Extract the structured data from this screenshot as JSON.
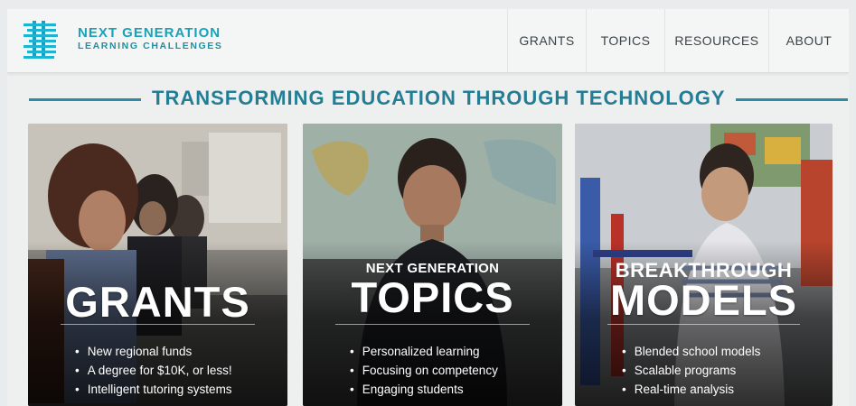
{
  "colors": {
    "brand": "#18a2b8",
    "tagline": "#237e95",
    "rule": "#2b8aa5"
  },
  "logo": {
    "line1": "NEXT GENERATION",
    "line2": "LEARNING CHALLENGES",
    "icon": "stacked-bars-logo-icon"
  },
  "nav": {
    "items": [
      {
        "label": "GRANTS"
      },
      {
        "label": "TOPICS"
      },
      {
        "label": "RESOURCES"
      },
      {
        "label": "ABOUT"
      }
    ]
  },
  "tagline": "TRANSFORMING EDUCATION THROUGH TECHNOLOGY",
  "cards": [
    {
      "kicker": "",
      "title": "GRANTS",
      "bullets": [
        "New regional funds",
        "A degree for $10K, or less!",
        "Intelligent tutoring systems"
      ]
    },
    {
      "kicker": "NEXT GENERATION",
      "title": "TOPICS",
      "bullets": [
        "Personalized learning",
        "Focusing on competency",
        "Engaging students"
      ]
    },
    {
      "kicker": "BREAKTHROUGH",
      "title": "MODELS",
      "bullets": [
        "Blended school models",
        "Scalable programs",
        "Real-time analysis"
      ]
    }
  ]
}
